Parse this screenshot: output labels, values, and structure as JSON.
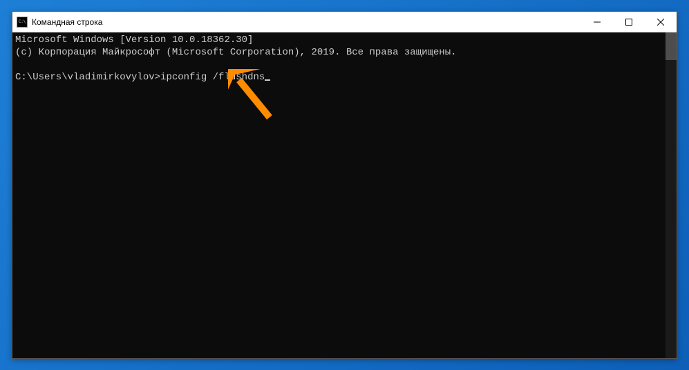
{
  "window": {
    "title": "Командная строка",
    "icon_label": "C:\\"
  },
  "terminal": {
    "line1": "Microsoft Windows [Version 10.0.18362.30]",
    "line2": "(c) Корпорация Майкрософт (Microsoft Corporation), 2019. Все права защищены.",
    "blank": "",
    "prompt": "C:\\Users\\vladimirkovylov>",
    "command": "ipconfig /flushdns"
  },
  "annotation": {
    "arrow_color": "#ff8c00"
  }
}
